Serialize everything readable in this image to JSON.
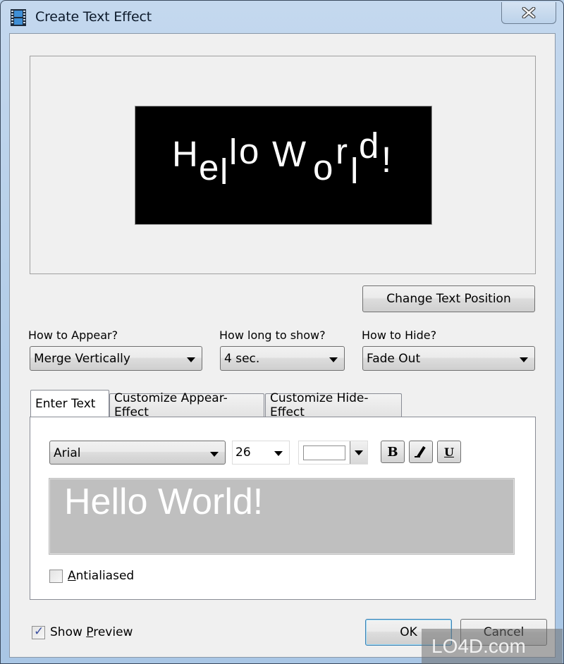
{
  "window": {
    "title": "Create Text Effect",
    "app_icon": "film-strip-icon",
    "close_icon": "close-icon"
  },
  "preview": {
    "text": "Hello World!",
    "background_color": "#000000",
    "text_color": "#ffffff",
    "glyphs": [
      "H",
      "e",
      "l",
      "l",
      "o",
      "W",
      "o",
      "r",
      "l",
      "d",
      "!"
    ]
  },
  "buttons": {
    "change_text_position": "Change Text Position",
    "ok": "OK",
    "cancel": "Cancel"
  },
  "options": {
    "appear": {
      "label": "How to Appear?",
      "value": "Merge Vertically"
    },
    "duration": {
      "label": "How long to show?",
      "value": "4 sec."
    },
    "hide": {
      "label": "How to Hide?",
      "value": "Fade Out"
    }
  },
  "tabs": [
    {
      "label": "Enter Text",
      "active": true
    },
    {
      "label": "Customize Appear-Effect",
      "active": false
    },
    {
      "label": "Customize Hide-Effect",
      "active": false
    }
  ],
  "text_panel": {
    "font": "Arial",
    "size": "26",
    "color": "#ffffff",
    "bold_label": "B",
    "italic_label": "I",
    "underline_label": "U",
    "text_value": "Hello World!",
    "editor_background": "#bfbfbf",
    "antialiased_label": "Antialiased",
    "antialiased_checked": false
  },
  "footer": {
    "show_preview_label": "Show Preview",
    "show_preview_checked": true
  },
  "watermark": "LO4D.com"
}
